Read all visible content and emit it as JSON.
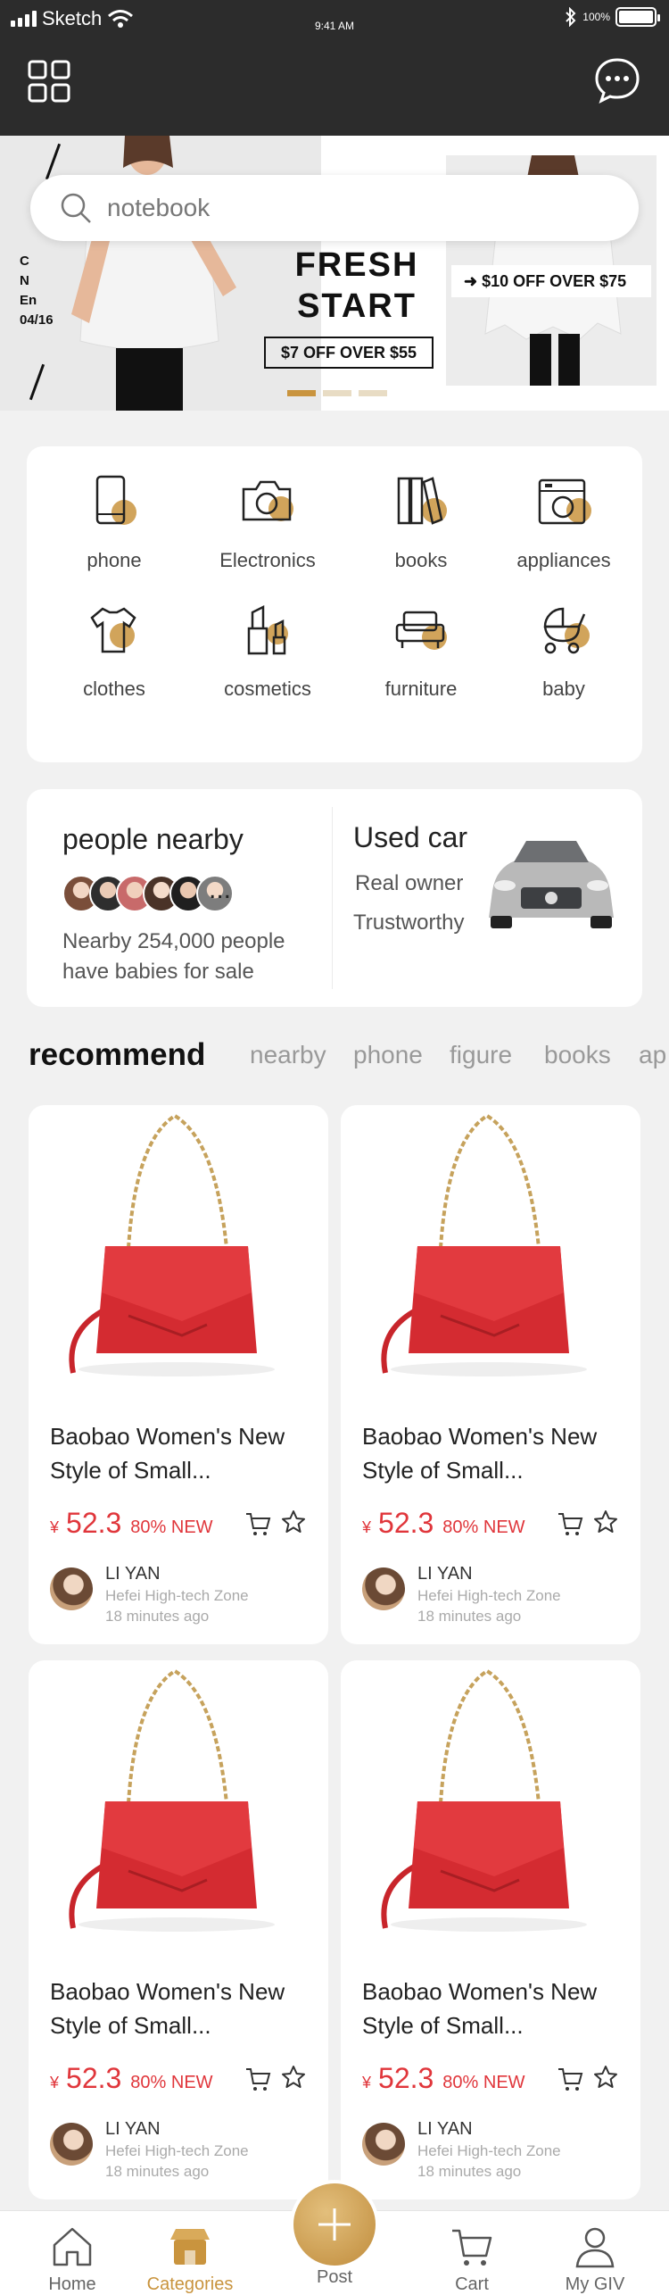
{
  "status": {
    "carrier": "Sketch",
    "time": "9:41 AM",
    "battery": "100%"
  },
  "header": {
    "menu_icon": "grid-icon",
    "message_icon": "chat-bubble-icon"
  },
  "banner": {
    "side_text": [
      "C",
      "N",
      "En",
      "04/16"
    ],
    "headline": [
      "FRESH",
      "START"
    ],
    "offer_left": "$7 OFF OVER $55",
    "offer_right": "$10 OFF OVER $75",
    "active_slide": 0,
    "slide_count": 3
  },
  "search": {
    "placeholder": "notebook"
  },
  "categories": [
    {
      "label": "phone",
      "icon": "phone-icon"
    },
    {
      "label": "Electronics",
      "icon": "camera-icon"
    },
    {
      "label": "books",
      "icon": "books-icon"
    },
    {
      "label": "appliances",
      "icon": "appliance-icon"
    },
    {
      "label": "clothes",
      "icon": "tshirt-icon"
    },
    {
      "label": "cosmetics",
      "icon": "lipstick-icon"
    },
    {
      "label": "furniture",
      "icon": "sofa-icon"
    },
    {
      "label": "baby",
      "icon": "stroller-icon"
    }
  ],
  "nearby": {
    "title": "people nearby",
    "more": "...",
    "description": "Nearby 254,000 people have babies for sale"
  },
  "used_car": {
    "title": "Used car",
    "line1": "Real owner",
    "line2": "Trustworthy"
  },
  "recommend": {
    "title": "recommend",
    "tabs": [
      "nearby",
      "phone",
      "figure",
      "books",
      "ap"
    ]
  },
  "products": [
    {
      "name": "Baobao Women's New Style of Small...",
      "currency": "¥",
      "price": "52.3",
      "condition": "80% NEW",
      "seller": "LI YAN",
      "location": "Hefei High-tech Zone",
      "posted": "18 minutes ago"
    },
    {
      "name": "Baobao Women's New Style of Small...",
      "currency": "¥",
      "price": "52.3",
      "condition": "80% NEW",
      "seller": "LI YAN",
      "location": "Hefei High-tech Zone",
      "posted": "18 minutes ago"
    },
    {
      "name": "Baobao Women's New Style of Small...",
      "currency": "¥",
      "price": "52.3",
      "condition": "80% NEW",
      "seller": "LI YAN",
      "location": "Hefei High-tech Zone",
      "posted": "18 minutes ago"
    },
    {
      "name": "Baobao Women's New Style of Small...",
      "currency": "¥",
      "price": "52.3",
      "condition": "80% NEW",
      "seller": "LI YAN",
      "location": "Hefei High-tech Zone",
      "posted": "18 minutes ago"
    }
  ],
  "tabbar": {
    "items": [
      {
        "label": "Home",
        "icon": "home-icon"
      },
      {
        "label": "Categories",
        "icon": "shop-icon"
      },
      {
        "label": "Post",
        "icon": "plus-icon"
      },
      {
        "label": "Cart",
        "icon": "cart-icon"
      },
      {
        "label": "My GIV",
        "icon": "user-icon"
      }
    ],
    "active_index": 1
  },
  "colors": {
    "accent": "#c9943e",
    "price": "#e0363b",
    "header_bg": "#2c2c2c",
    "page_bg": "#f1f1f1"
  }
}
